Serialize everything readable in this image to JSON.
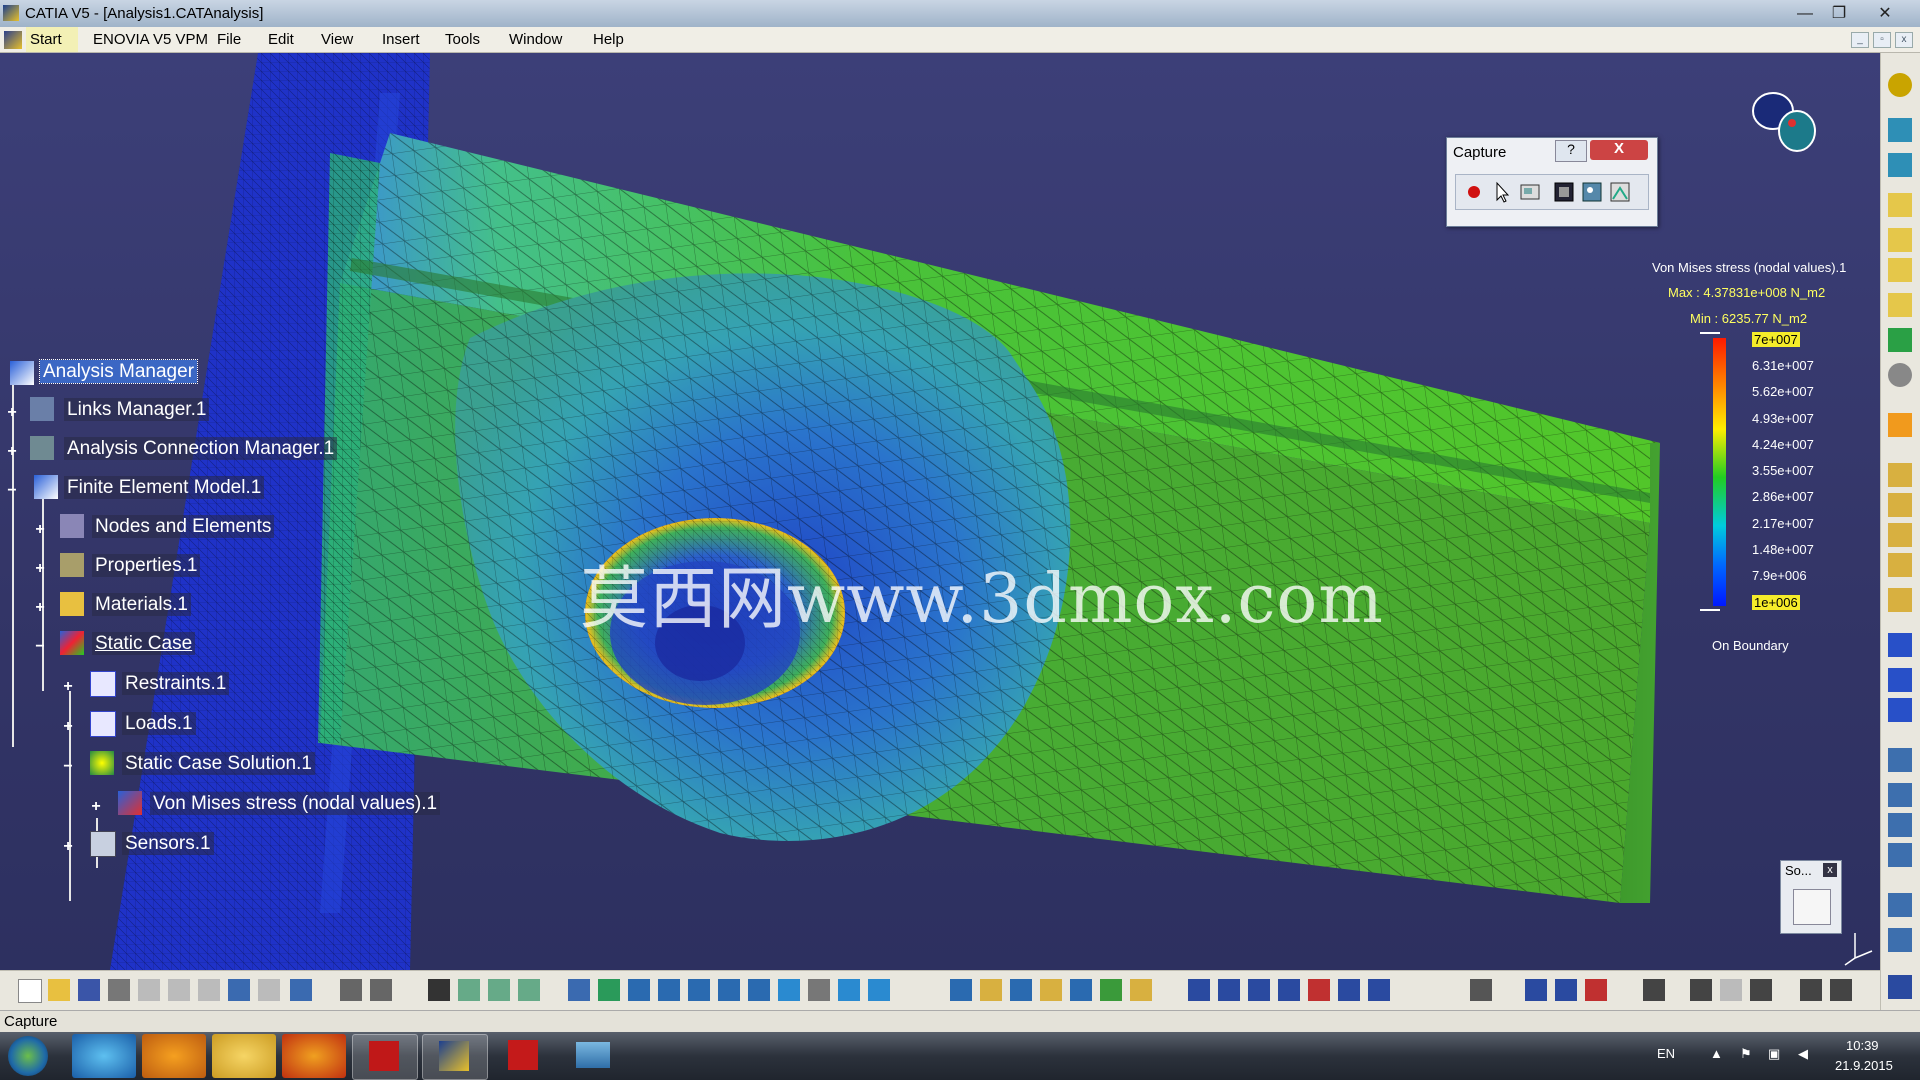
{
  "window": {
    "title": "CATIA V5 - [Analysis1.CATAnalysis]",
    "controls": {
      "minimize": "—",
      "maximize": "❐",
      "close": "✕"
    }
  },
  "menubar": {
    "items": [
      "Start",
      "ENOVIA V5 VPM",
      "File",
      "Edit",
      "View",
      "Insert",
      "Tools",
      "Window",
      "Help"
    ]
  },
  "tree": {
    "items": [
      {
        "label": "Analysis Manager",
        "icon": "analysis-manager-icon"
      },
      {
        "label": "Links Manager.1",
        "icon": "links-manager-icon"
      },
      {
        "label": "Analysis Connection Manager.1",
        "icon": "connection-manager-icon"
      },
      {
        "label": "Finite Element Model.1",
        "icon": "fem-model-icon"
      },
      {
        "label": "Nodes and Elements",
        "icon": "mesh-nodes-icon"
      },
      {
        "label": "Properties.1",
        "icon": "properties-icon"
      },
      {
        "label": "Materials.1",
        "icon": "folder-icon"
      },
      {
        "label": "Static Case",
        "icon": "static-case-icon"
      },
      {
        "label": "Restraints.1",
        "icon": "restraints-icon"
      },
      {
        "label": "Loads.1",
        "icon": "loads-icon"
      },
      {
        "label": "Static Case Solution.1",
        "icon": "solution-icon"
      },
      {
        "label": "Von Mises stress (nodal values).1",
        "icon": "von-mises-icon"
      },
      {
        "label": "Sensors.1",
        "icon": "sensors-icon"
      }
    ]
  },
  "watermark": "莫西网www.3dmox.com",
  "legend": {
    "title": "Von Mises stress (nodal values).1",
    "max": "Max : 4.37831e+008 N_m2",
    "min": "Min : 6235.77 N_m2",
    "ticks": [
      "7e+007",
      "6.31e+007",
      "5.62e+007",
      "4.93e+007",
      "4.24e+007",
      "3.55e+007",
      "2.86e+007",
      "2.17e+007",
      "1.48e+007",
      "7.9e+006",
      "1e+006"
    ],
    "footer": "On Boundary",
    "colors": {
      "top": "#ff1e00",
      "mid": "#22cc22",
      "bottom": "#0018ff",
      "highlight": "#f5ec2a"
    }
  },
  "capture_dialog": {
    "title": "Capture",
    "help": "?",
    "close": "X",
    "tools": [
      "record-icon",
      "select-cursor-icon",
      "capture-options-icon",
      "capture-image-icon",
      "album-icon",
      "gallery-icon"
    ]
  },
  "so_panel": {
    "title": "So...",
    "close": "x"
  },
  "statusbar": {
    "text": "Capture"
  },
  "taskbar": {
    "language": "EN",
    "time": "10:39",
    "date": "21.9.2015"
  }
}
